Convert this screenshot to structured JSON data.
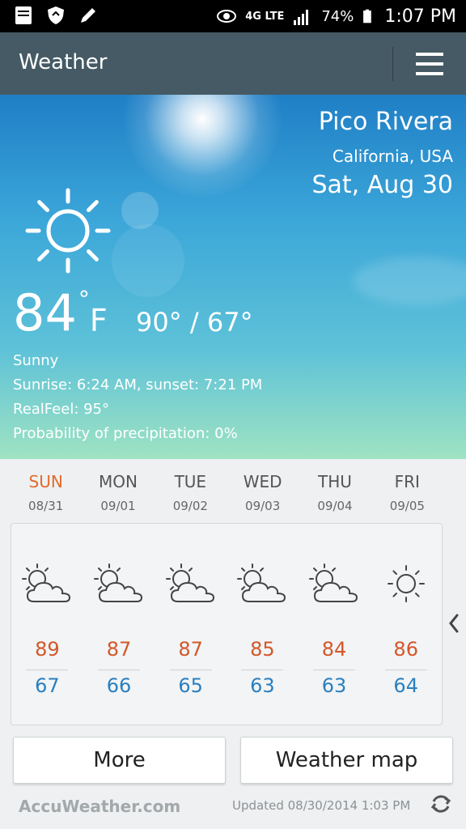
{
  "status_bar": {
    "battery": "74%",
    "time": "1:07 PM",
    "network": "4G LTE",
    "icons": [
      "bible-app-icon",
      "shield-icon",
      "pencil-icon",
      "eye-icon",
      "signal-icon",
      "battery-icon"
    ]
  },
  "app_bar": {
    "title": "Weather",
    "menu_icon": "hamburger-menu-icon"
  },
  "current": {
    "city": "Pico Rivera",
    "region": "California, USA",
    "date": "Sat, Aug 30",
    "temp": "84",
    "degree_symbol": "°",
    "unit": "F",
    "hi_lo": "90° / 67°",
    "condition": "Sunny",
    "sun_times": "Sunrise: 6:24  AM, sunset: 7:21  PM",
    "realfeel": "RealFeel: 95°",
    "precipitation": "Probability of precipitation: 0%",
    "icon": "sunny-icon"
  },
  "forecast": [
    {
      "day": "SUN",
      "date": "08/31",
      "hi": "89",
      "lo": "67",
      "icon": "partly-sunny-icon"
    },
    {
      "day": "MON",
      "date": "09/01",
      "hi": "87",
      "lo": "66",
      "icon": "partly-sunny-icon"
    },
    {
      "day": "TUE",
      "date": "09/02",
      "hi": "87",
      "lo": "65",
      "icon": "partly-sunny-icon"
    },
    {
      "day": "WED",
      "date": "09/03",
      "hi": "85",
      "lo": "63",
      "icon": "partly-sunny-icon"
    },
    {
      "day": "THU",
      "date": "09/04",
      "hi": "84",
      "lo": "63",
      "icon": "partly-sunny-icon"
    },
    {
      "day": "FRI",
      "date": "09/05",
      "hi": "86",
      "lo": "64",
      "icon": "sunny-icon"
    }
  ],
  "buttons": {
    "more": "More",
    "weather_map": "Weather map"
  },
  "footer": {
    "brand": "AccuWeather.com",
    "updated": "Updated 08/30/2014 1:03 PM"
  },
  "colors": {
    "app_bar": "#455a64",
    "today_label": "#e06b2c",
    "high_temp": "#d3572a",
    "low_temp": "#2a7fbf"
  }
}
